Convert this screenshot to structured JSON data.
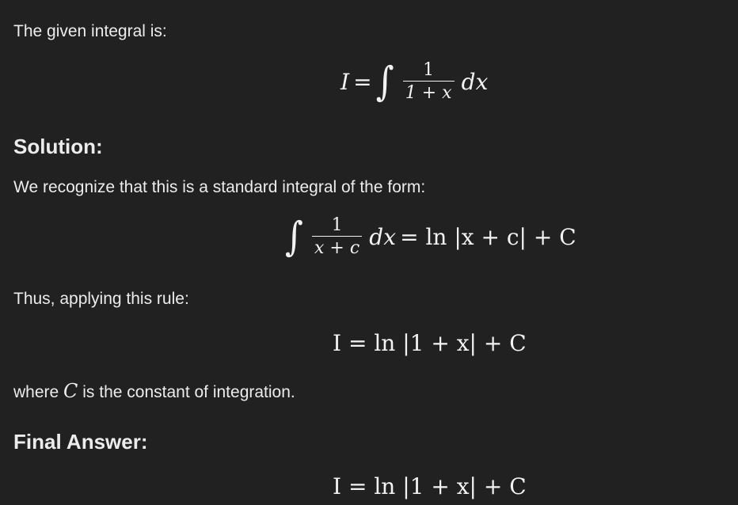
{
  "intro_text": "The given integral is:",
  "eq1": {
    "lhs": "I",
    "equals": "=",
    "integral": "∫",
    "num": "1",
    "den": "1 + x",
    "dx": "dx"
  },
  "solution_heading": "Solution:",
  "recognize_text": "We recognize that this is a standard integral of the form:",
  "eq2": {
    "integral": "∫",
    "num": "1",
    "den": "x + c",
    "dx": "dx",
    "rhs": "= ln |x + c| + C"
  },
  "thus_text": "Thus, applying this rule:",
  "eq3": "I = ln |1 + x| + C",
  "where_text": {
    "before": "where ",
    "var": "C",
    "after": " is the constant of integration."
  },
  "final_heading": "Final Answer:",
  "eq4": "I = ln |1 + x| + C"
}
